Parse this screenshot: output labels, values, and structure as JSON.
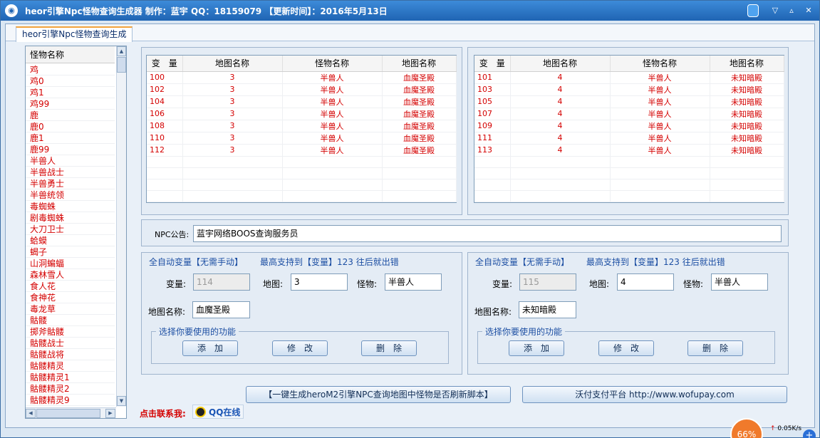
{
  "window": {
    "title": "heor引擎Npc怪物查询生成器  制作：蓝宇  QQ：18159079  【更新时间】：2016年5月13日",
    "app_icon": "app-icon",
    "minimize_glyph": "▽",
    "restore_glyph": "▵",
    "close_glyph": "✕"
  },
  "tab": {
    "label": "heor引擎Npc怪物查询生成"
  },
  "monster_list": {
    "header": "怪物名称",
    "items": [
      "鸡",
      "鸡0",
      "鸡1",
      "鸡99",
      "鹿",
      "鹿0",
      "鹿1",
      "鹿99",
      "半兽人",
      "半兽战士",
      "半兽勇士",
      "半兽统领",
      "毒蜘蛛",
      "剧毒蜘蛛",
      "大刀卫士",
      "蛤蟆",
      "蝎子",
      "山洞蝙蝠",
      "森林雪人",
      "食人花",
      "食神花",
      "毒龙草",
      "骷髅",
      "掷斧骷髅",
      "骷髅战士",
      "骷髅战将",
      "骷髅精灵",
      "骷髅精灵1",
      "骷髅精灵2",
      "骷髅精灵9"
    ]
  },
  "grid_left": {
    "columns": [
      "变　量",
      "地图名称",
      "怪物名称",
      "地图名称"
    ],
    "rows": [
      [
        "100",
        "3",
        "半兽人",
        "血魔圣殿"
      ],
      [
        "102",
        "3",
        "半兽人",
        "血魔圣殿"
      ],
      [
        "104",
        "3",
        "半兽人",
        "血魔圣殿"
      ],
      [
        "106",
        "3",
        "半兽人",
        "血魔圣殿"
      ],
      [
        "108",
        "3",
        "半兽人",
        "血魔圣殿"
      ],
      [
        "110",
        "3",
        "半兽人",
        "血魔圣殿"
      ],
      [
        "112",
        "3",
        "半兽人",
        "血魔圣殿"
      ]
    ]
  },
  "grid_right": {
    "columns": [
      "变　量",
      "地图名称",
      "怪物名称",
      "地图名称"
    ],
    "rows": [
      [
        "101",
        "4",
        "半兽人",
        "未知暗殿"
      ],
      [
        "103",
        "4",
        "半兽人",
        "未知暗殿"
      ],
      [
        "105",
        "4",
        "半兽人",
        "未知暗殿"
      ],
      [
        "107",
        "4",
        "半兽人",
        "未知暗殿"
      ],
      [
        "109",
        "4",
        "半兽人",
        "未知暗殿"
      ],
      [
        "111",
        "4",
        "半兽人",
        "未知暗殿"
      ],
      [
        "113",
        "4",
        "半兽人",
        "未知暗殿"
      ]
    ]
  },
  "npc": {
    "label": "NPC公告:",
    "value": "蓝宇网络BOOS查询服务员"
  },
  "form_left": {
    "auto_note": "全自动变量【无需手动】",
    "max_note": "最高支持到【变量】123 往后就出错",
    "var_label": "变量:",
    "var_value": "114",
    "map_label": "地图:",
    "map_value": "3",
    "monster_label": "怪物:",
    "monster_value": "半兽人",
    "mapname_label": "地图名称:",
    "mapname_value": "血魔圣殿",
    "group_caption": "选择你要使用的功能",
    "add": "添　加",
    "edit": "修　改",
    "delete": "删　除"
  },
  "form_right": {
    "auto_note": "全自动变量【无需手动】",
    "max_note": "最高支持到【变量】123 往后就出错",
    "var_label": "变量:",
    "var_value": "115",
    "map_label": "地图:",
    "map_value": "4",
    "monster_label": "怪物:",
    "monster_value": "半兽人",
    "mapname_label": "地图名称:",
    "mapname_value": "未知暗殿",
    "group_caption": "选择你要使用的功能",
    "add": "添　加",
    "edit": "修　改",
    "delete": "删　除"
  },
  "actions": {
    "generate": "【一键生成heroM2引擎NPC查询地图中怪物是否刷新脚本】",
    "pay": "沃付支付平台 http://www.wofupay.com"
  },
  "contact": {
    "label": "点击联系我:",
    "qq": "QQ在线"
  },
  "tray": {
    "percent": "66%",
    "speed": "0.05K/s"
  }
}
